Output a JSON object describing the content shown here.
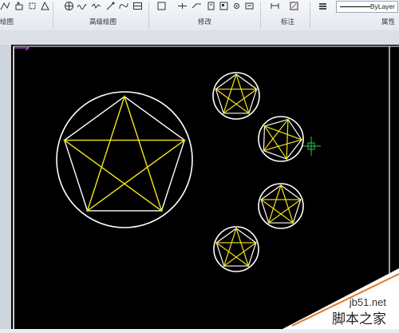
{
  "ribbon": {
    "groups": [
      {
        "id": "draw",
        "label": "绘图"
      },
      {
        "id": "advanced_draw",
        "label": "高级绘图"
      },
      {
        "id": "modify",
        "label": "修改"
      },
      {
        "id": "annotate",
        "label": "标注"
      },
      {
        "id": "properties",
        "label": "属性"
      }
    ],
    "linetype_value": "ByLayer"
  },
  "canvas": {
    "background": "#000000",
    "circle_color": "#ffffff",
    "star_color": "#f5e61a",
    "ucs_color": "#b44dd6",
    "crosshair_color": "#2fc24f",
    "objects": [
      {
        "kind": "circumscribed-pentagram",
        "size": "large"
      },
      {
        "kind": "circumscribed-pentagram",
        "size": "small"
      },
      {
        "kind": "circumscribed-pentagram",
        "size": "small"
      },
      {
        "kind": "circumscribed-pentagram",
        "size": "small"
      },
      {
        "kind": "circumscribed-pentagram",
        "size": "small"
      }
    ]
  },
  "watermark": {
    "site": "jb51.net",
    "name": "脚本之家"
  }
}
